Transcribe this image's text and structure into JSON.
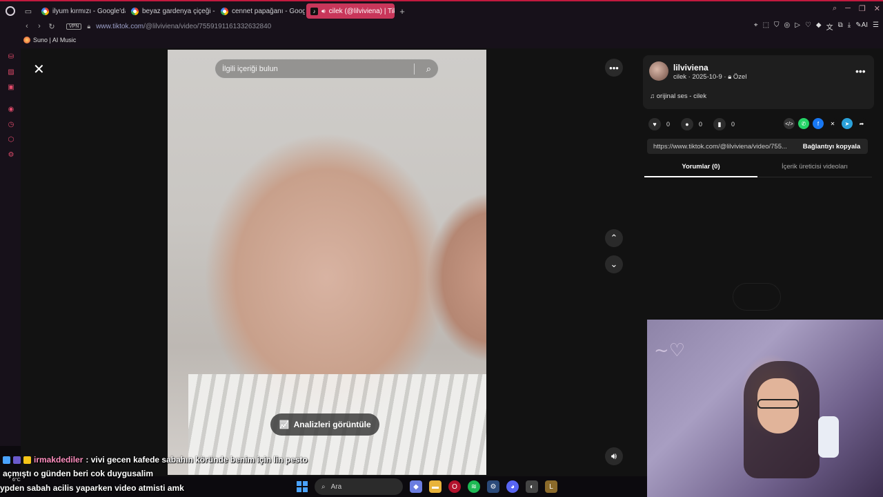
{
  "browser": {
    "tabs": [
      {
        "label": "ilyum kırmızı - Google'da",
        "icon": "google-icon",
        "active": false
      },
      {
        "label": "beyaz gardenya çiçeği - G",
        "icon": "google-icon",
        "active": false
      },
      {
        "label": "cennet papağanı - Google",
        "icon": "google-icon",
        "active": false
      },
      {
        "label": "cilek (@lilviviena) | Tik",
        "icon": "tiktok-icon",
        "active": true
      }
    ],
    "url_host": "www.tiktok.com",
    "url_path": "/@lilviviena/video/7559191161332632840",
    "vpn_label": "VPN",
    "bookmark": "Suno | AI Music",
    "ai_label": "AI"
  },
  "video": {
    "search_placeholder": "İlgili içeriği bulun",
    "analytics_label": "Analizleri görüntüle"
  },
  "panel": {
    "author_name": "lilviviena",
    "author_meta": "cilek · 2025-10-9 · ",
    "privacy": "Özel",
    "sound": "orijinal ses - cilek",
    "likes": "0",
    "comments": "0",
    "saves": "0",
    "link": "https://www.tiktok.com/@lilviviena/video/755...",
    "copy_label": "Bağlantıyı kopyala",
    "tab_comments": "Yorumlar (0)",
    "tab_creator": "İçerik üreticisi videoları"
  },
  "chat": {
    "user": "irmakdediler",
    "line1": " : vivi gecen kafede sabahın köründe benim için lin pesto",
    "line2": "açmıştı o günden beri cok duygusalim",
    "line3": "ypden sabah acilis yaparken video atmisti amk"
  },
  "weather": "6°C",
  "taskbar": {
    "search_label": "Ara"
  },
  "colors": {
    "accent": "#c8365a",
    "brand_red": "#c21a3e"
  }
}
